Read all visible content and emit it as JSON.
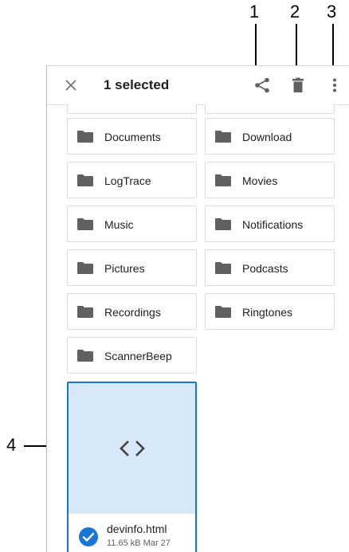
{
  "callouts": [
    "1",
    "2",
    "3",
    "4"
  ],
  "appbar": {
    "title": "1 selected",
    "icons": [
      "close-icon",
      "share-icon",
      "delete-icon",
      "more-vert-icon"
    ]
  },
  "folders": {
    "partial_top": [
      "",
      ""
    ],
    "items": [
      "Documents",
      "Download",
      "LogTrace",
      "Movies",
      "Music",
      "Notifications",
      "Pictures",
      "Podcasts",
      "Recordings",
      "Ringtones",
      "ScannerBeep"
    ]
  },
  "file": {
    "name": "devinfo.html",
    "size": "11.65 kB",
    "date": "Mar 27",
    "meta": "11.65 kB Mar 27",
    "selected": true,
    "preview_icon": "code-icon"
  },
  "colors": {
    "accent": "#1976d2",
    "selected_bg": "#d7e8f9",
    "folder_icon": "#616161",
    "appbar_icon": "#616161"
  }
}
